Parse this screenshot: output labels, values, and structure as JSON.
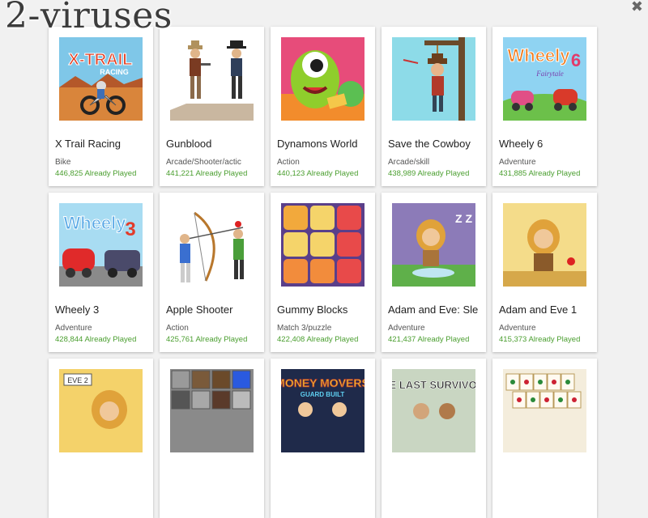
{
  "watermark": "2-viruses",
  "close_icon": "close-icon",
  "games": [
    {
      "title": "X Trail Racing",
      "category": "Bike",
      "plays": "446,825 Already Played",
      "thumb": "xtrail"
    },
    {
      "title": "Gunblood",
      "category": "Arcade/Shooter/actic",
      "plays": "441,221 Already Played",
      "thumb": "gunblood"
    },
    {
      "title": "Dynamons World",
      "category": "Action",
      "plays": "440,123 Already Played",
      "thumb": "dynamons"
    },
    {
      "title": "Save the Cowboy",
      "category": "Arcade/skill",
      "plays": "438,989 Already Played",
      "thumb": "cowboy"
    },
    {
      "title": "Wheely 6",
      "category": "Adventure",
      "plays": "431,885 Already Played",
      "thumb": "wheely6"
    },
    {
      "title": "Wheely 3",
      "category": "Adventure",
      "plays": "428,844 Already Played",
      "thumb": "wheely3"
    },
    {
      "title": "Apple Shooter",
      "category": "Action",
      "plays": "425,761 Already Played",
      "thumb": "apple"
    },
    {
      "title": "Gummy Blocks",
      "category": "Match 3/puzzle",
      "plays": "422,408 Already Played",
      "thumb": "gummy"
    },
    {
      "title": "Adam and Eve: Sle",
      "category": "Adventure",
      "plays": "421,437 Already Played",
      "thumb": "adamsleep"
    },
    {
      "title": "Adam and Eve 1",
      "category": "Adventure",
      "plays": "415,373 Already Played",
      "thumb": "adam1"
    },
    {
      "title": "",
      "category": "",
      "plays": "",
      "thumb": "adam2"
    },
    {
      "title": "",
      "category": "",
      "plays": "",
      "thumb": "minecraft"
    },
    {
      "title": "",
      "category": "",
      "plays": "",
      "thumb": "money"
    },
    {
      "title": "",
      "category": "",
      "plays": "",
      "thumb": "lastsurvivors"
    },
    {
      "title": "",
      "category": "",
      "plays": "",
      "thumb": "mahjong"
    }
  ],
  "thumb_text": {
    "xtrail": "X-TRAIL",
    "xtrail_sub": "RACING",
    "wheely6": "Wheely",
    "wheely6_num": "6",
    "wheely6_sub": "Fairytale",
    "wheely3": "Wheely",
    "wheely3_num": "3",
    "adam2": "EVE 2",
    "money": "MONEY MOVERS",
    "money_sub": "GUARD BUILT",
    "lastsurvivors": "THE LAST SURVIVORS"
  }
}
